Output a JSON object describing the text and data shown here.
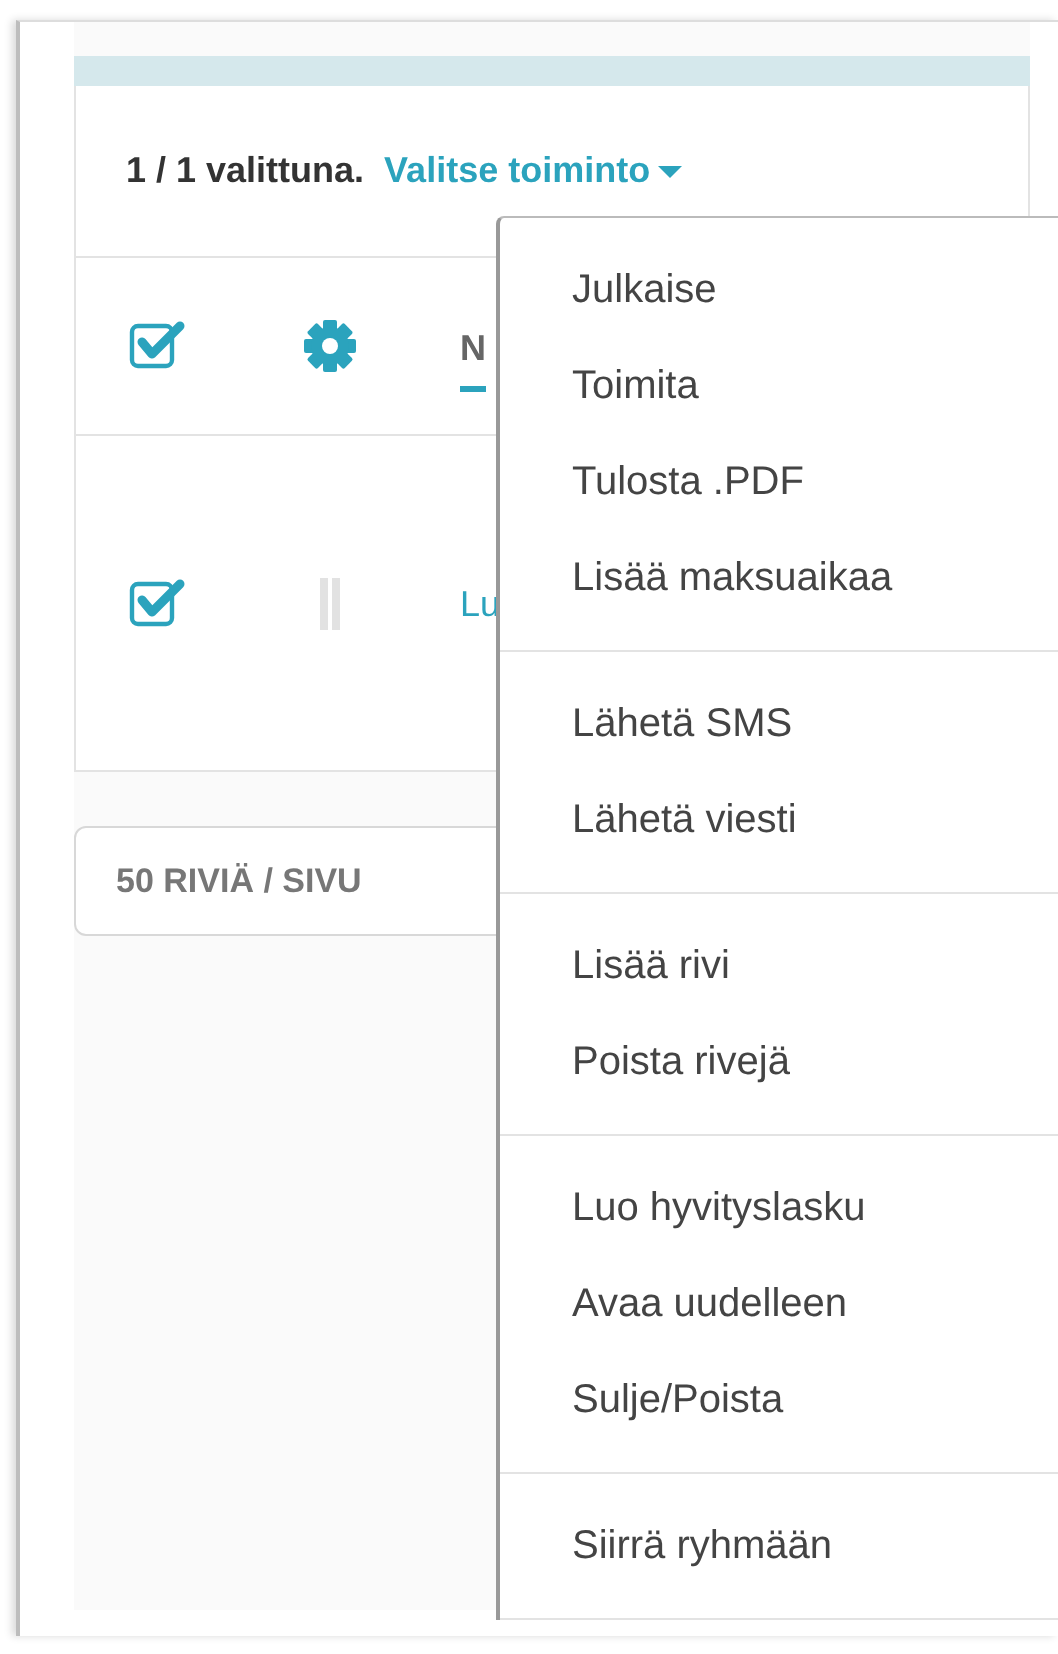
{
  "top_bar": {
    "selection_text": "1 / 1 valittuna.",
    "action_menu": {
      "label": "Valitse toiminto",
      "expanded": true
    }
  },
  "table": {
    "header": {
      "select_all_checked": true,
      "column_1": "N"
    },
    "rows": [
      {
        "checked": true,
        "column_1": "Lu"
      }
    ]
  },
  "page_size": "50 RIVIÄ / SIVU",
  "menu": {
    "groups": [
      {
        "items": [
          {
            "label": "Julkaise"
          },
          {
            "label": "Toimita"
          },
          {
            "label": "Tulosta .PDF"
          },
          {
            "label": "Lisää maksuaikaa"
          }
        ]
      },
      {
        "items": [
          {
            "label": "Lähetä SMS"
          },
          {
            "label": "Lähetä viesti"
          }
        ]
      },
      {
        "items": [
          {
            "label": "Lisää rivi"
          },
          {
            "label": "Poista rivejä"
          }
        ]
      },
      {
        "items": [
          {
            "label": "Luo hyvityslasku"
          },
          {
            "label": "Avaa uudelleen"
          },
          {
            "label": "Sulje/Poista"
          }
        ]
      },
      {
        "items": [
          {
            "label": "Siirrä ryhmään"
          }
        ]
      }
    ]
  }
}
